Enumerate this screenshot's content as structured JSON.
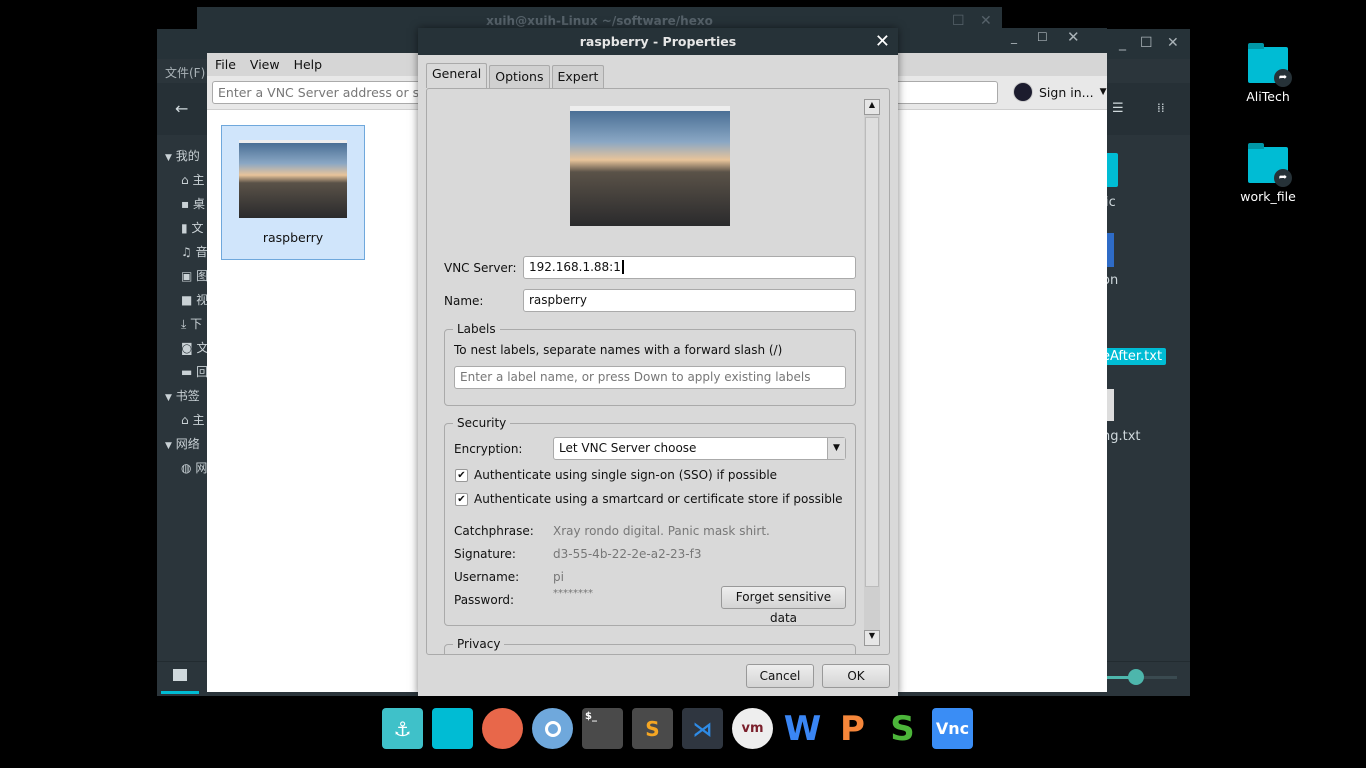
{
  "terminal": {
    "title": "xuih@xuih-Linux ~/software/hexo"
  },
  "file_manager": {
    "menu": "文件(F)",
    "sidebar": {
      "groups": [
        {
          "label": "我的"
        },
        {
          "label": "书签"
        },
        {
          "label": "网络"
        }
      ],
      "items": [
        {
          "icon": "home-icon",
          "label": "主"
        },
        {
          "icon": "desktop-icon",
          "label": "桌"
        },
        {
          "icon": "document-icon",
          "label": "文"
        },
        {
          "icon": "music-icon",
          "label": "音"
        },
        {
          "icon": "picture-icon",
          "label": "图"
        },
        {
          "icon": "video-icon",
          "label": "视"
        },
        {
          "icon": "download-icon",
          "label": "下"
        },
        {
          "icon": "disk-icon",
          "label": "文"
        },
        {
          "icon": "trash-icon",
          "label": "回"
        }
      ],
      "bookmarks": [
        {
          "icon": "home-icon",
          "label": "主"
        }
      ],
      "network": [
        {
          "icon": "globe-icon",
          "label": "网"
        }
      ]
    },
    "files": [
      "ic",
      "on",
      "eAfter.txt",
      "ng.txt"
    ],
    "zoom_slider_fraction": 0.45,
    "accent": "#00bcd4"
  },
  "vnc_viewer": {
    "menu": [
      "File",
      "View",
      "Help"
    ],
    "address_placeholder": "Enter a VNC Server address or search",
    "signin": "Sign in...",
    "connections": [
      {
        "name": "raspberry"
      }
    ]
  },
  "dialog": {
    "title": "raspberry - Properties",
    "tabs": [
      "General",
      "Options",
      "Expert"
    ],
    "active_tab": "General",
    "vnc_server_label": "VNC Server:",
    "vnc_server_value": "192.168.1.88:1",
    "name_label": "Name:",
    "name_value": "raspberry",
    "labels_group": "Labels",
    "labels_hint": "To nest labels, separate names with a forward slash (/)",
    "labels_placeholder": "Enter a label name, or press Down to apply existing labels",
    "security_group": "Security",
    "encryption_label": "Encryption:",
    "encryption_value": "Let VNC Server choose",
    "sso_label": "Authenticate using single sign-on (SSO) if possible",
    "sso_checked": true,
    "smartcard_label": "Authenticate using a smartcard or certificate store if possible",
    "smartcard_checked": true,
    "catchphrase_label": "Catchphrase:",
    "catchphrase_value": "Xray rondo digital. Panic mask shirt.",
    "signature_label": "Signature:",
    "signature_value": "d3-55-4b-22-2e-a2-23-f3",
    "username_label": "Username:",
    "username_value": "pi",
    "password_label": "Password:",
    "password_value": "********",
    "forget_button": "Forget sensitive data",
    "privacy_group": "Privacy",
    "cancel": "Cancel",
    "ok": "OK"
  },
  "desktop": {
    "icons": [
      {
        "label": "AliTech"
      },
      {
        "label": "work_file"
      }
    ]
  },
  "dock": {
    "apps": [
      {
        "name": "anchor-icon",
        "color": "#3fc1c9"
      },
      {
        "name": "files-icon",
        "color": "#00bcd4"
      },
      {
        "name": "firefox-icon",
        "color": "#e8674a"
      },
      {
        "name": "chromium-icon",
        "color": "#6fa8dc"
      },
      {
        "name": "terminal-icon",
        "color": "#4a4a4a",
        "glyph": "$_"
      },
      {
        "name": "sublime-icon",
        "color": "#4a4a4a"
      },
      {
        "name": "vscode-icon",
        "color": "#2f3640"
      },
      {
        "name": "vmware-icon",
        "color": "#eeeeee"
      },
      {
        "name": "wps-writer-icon",
        "color": "#3a86f5"
      },
      {
        "name": "wps-presentation-icon",
        "color": "#f5863a"
      },
      {
        "name": "wps-spreadsheet-icon",
        "color": "#4cb63a"
      },
      {
        "name": "vnc-viewer-icon",
        "color": "#3a8df5"
      }
    ]
  }
}
